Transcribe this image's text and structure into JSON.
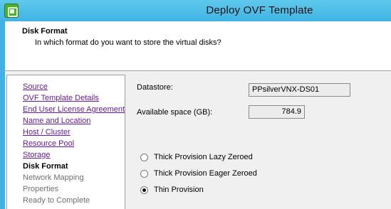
{
  "window": {
    "title": "Deploy OVF Template",
    "icon": "vsphere-app-icon"
  },
  "header": {
    "step_title": "Disk Format",
    "description": "In which format do you want to store the virtual disks?"
  },
  "nav": {
    "items": [
      {
        "label": "Source",
        "state": "link"
      },
      {
        "label": "OVF Template Details",
        "state": "link"
      },
      {
        "label": "End User License Agreement",
        "state": "link"
      },
      {
        "label": "Name and Location",
        "state": "link"
      },
      {
        "label": "Host / Cluster",
        "state": "link"
      },
      {
        "label": "Resource Pool",
        "state": "link"
      },
      {
        "label": "Storage",
        "state": "link"
      },
      {
        "label": "Disk Format",
        "state": "current"
      },
      {
        "label": "Network Mapping",
        "state": "disabled"
      },
      {
        "label": "Properties",
        "state": "disabled"
      },
      {
        "label": "Ready to Complete",
        "state": "disabled"
      }
    ]
  },
  "datastore": {
    "label": "Datastore:",
    "value": "PPsilverVNX-DS01"
  },
  "available_space": {
    "label": "Available space (GB):",
    "value": "784.9"
  },
  "disk_format": {
    "options": [
      {
        "label": "Thick Provision Lazy Zeroed",
        "checked": false
      },
      {
        "label": "Thick Provision Eager Zeroed",
        "checked": false
      },
      {
        "label": "Thin Provision",
        "checked": true
      }
    ]
  },
  "colors": {
    "accent": "#3fb4e4",
    "link": "#6a1aa0"
  }
}
